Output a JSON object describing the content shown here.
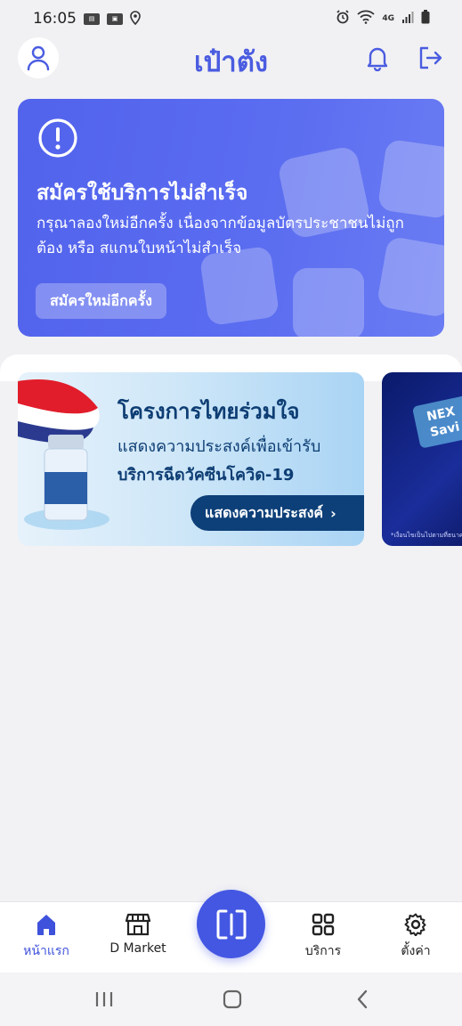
{
  "status_bar": {
    "time": "16:05",
    "network": "4G"
  },
  "header": {
    "title": "เป๋าตัง"
  },
  "alert": {
    "title": "สมัครใช้บริการไม่สำเร็จ",
    "message": "กรุณาลองใหม่อีกครั้ง เนื่องจากข้อมูลบัตรประชาชนไม่ถูกต้อง หรือ สแกนใบหน้าไม่สำเร็จ",
    "button_label": "สมัครใหม่อีกครั้ง",
    "background_color": "#5263ec"
  },
  "banners": [
    {
      "title": "โครงการไทยร่วมใจ",
      "line1": "แสดงความประสงค์เพื่อเข้ารับ",
      "line2": "บริการฉีดวัคซีนโควิด-19",
      "button_label": "แสดงความประสงค์"
    },
    {
      "tag_text": "NEX Savi",
      "note": "*เงื่อนไขเป็นไปตามที่ธนาคาร"
    }
  ],
  "bottom_nav": {
    "items": [
      {
        "label": "หน้าแรก",
        "icon": "home-icon",
        "active": true
      },
      {
        "label": "D Market",
        "icon": "store-icon",
        "active": false
      },
      {
        "label": "บริการ",
        "icon": "grid-icon",
        "active": false
      },
      {
        "label": "ตั้งค่า",
        "icon": "gear-icon",
        "active": false
      }
    ],
    "scan_icon": "scan-icon",
    "accent_color": "#4457e3"
  }
}
